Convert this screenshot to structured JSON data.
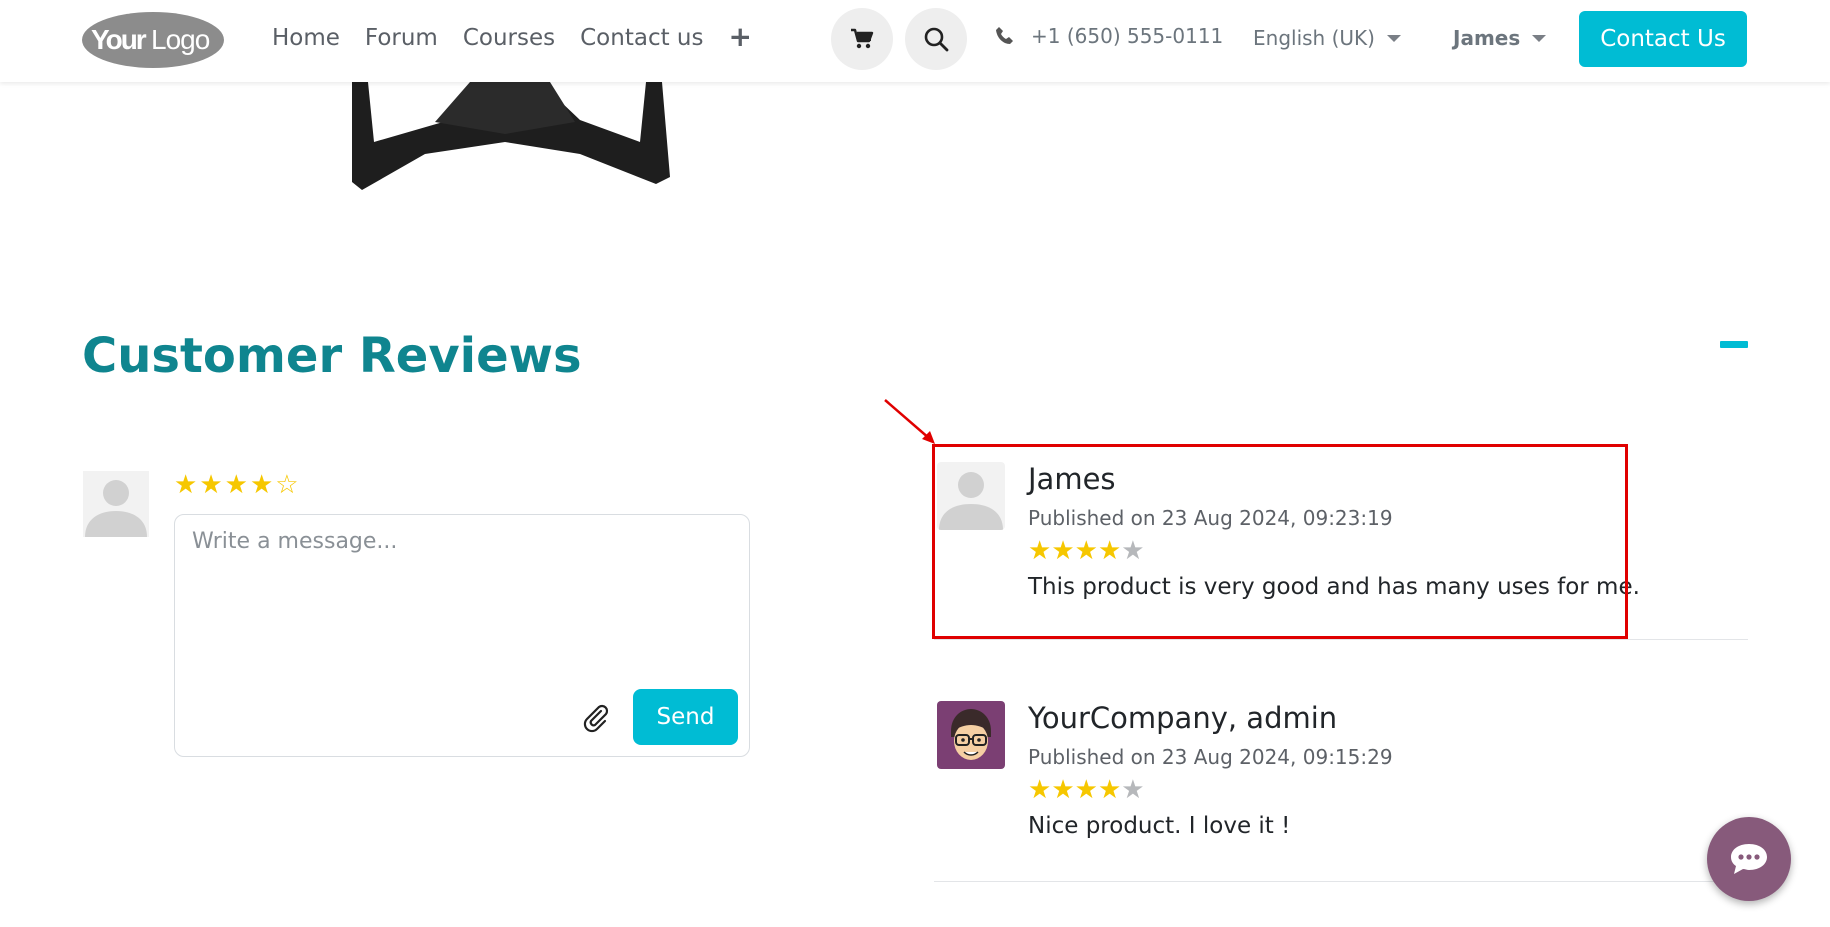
{
  "header": {
    "logo_text": "YourLogo",
    "nav": [
      {
        "label": "Home"
      },
      {
        "label": "Forum"
      },
      {
        "label": "Courses"
      },
      {
        "label": "Contact us"
      }
    ],
    "nav_more": "+",
    "cart_icon": "cart-icon",
    "search_icon": "search-icon",
    "phone": "+1 (650) 555-0111",
    "language": "English (UK)",
    "user": "James",
    "contact_button": "Contact Us",
    "accent_color": "#00bcd4"
  },
  "reviews_section": {
    "title": "Customer Reviews",
    "title_color": "#0f858f",
    "composer": {
      "rating": 4,
      "rating_max": 5,
      "placeholder": "Write a message...",
      "send_label": "Send"
    },
    "reviews": [
      {
        "author": "James",
        "published": "Published on 23 Aug 2024, 09:23:19",
        "rating": 4,
        "rating_max": 5,
        "text": "This product is very good and has many uses for me.",
        "highlighted": true
      },
      {
        "author": "YourCompany, admin",
        "published": "Published on 23 Aug 2024, 09:15:29",
        "rating": 4,
        "rating_max": 5,
        "text": "Nice product. I love it !",
        "highlighted": false
      }
    ]
  },
  "chat_icon": "livechat-icon"
}
